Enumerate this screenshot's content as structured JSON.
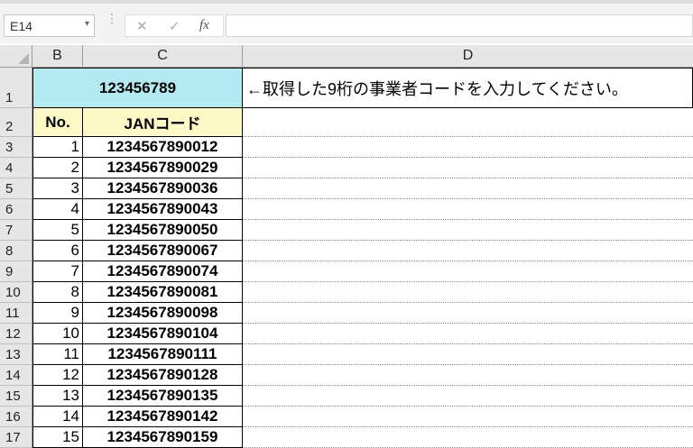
{
  "formula_bar": {
    "name_box": "E14",
    "name_box_caret": "▾",
    "separator": "⋮",
    "cancel_icon": "✕",
    "enter_icon": "✓",
    "function_icon": "fx",
    "formula_value": ""
  },
  "columns": [
    {
      "label": "B"
    },
    {
      "label": "C"
    },
    {
      "label": "D"
    }
  ],
  "row_numbers": [
    "1",
    "2",
    "3",
    "4",
    "5",
    "6",
    "7",
    "8",
    "9",
    "10",
    "11",
    "12",
    "13",
    "14",
    "15",
    "16",
    "17"
  ],
  "sheet": {
    "business_code": "123456789",
    "note": "←取得した9桁の事業者コードを入力してください。",
    "header_no": "No.",
    "header_jan": "JANコード",
    "rows": [
      {
        "no": "1",
        "jan": "1234567890012"
      },
      {
        "no": "2",
        "jan": "1234567890029"
      },
      {
        "no": "3",
        "jan": "1234567890036"
      },
      {
        "no": "4",
        "jan": "1234567890043"
      },
      {
        "no": "5",
        "jan": "1234567890050"
      },
      {
        "no": "6",
        "jan": "1234567890067"
      },
      {
        "no": "7",
        "jan": "1234567890074"
      },
      {
        "no": "8",
        "jan": "1234567890081"
      },
      {
        "no": "9",
        "jan": "1234567890098"
      },
      {
        "no": "10",
        "jan": "1234567890104"
      },
      {
        "no": "11",
        "jan": "1234567890111"
      },
      {
        "no": "12",
        "jan": "1234567890128"
      },
      {
        "no": "13",
        "jan": "1234567890135"
      },
      {
        "no": "14",
        "jan": "1234567890142"
      },
      {
        "no": "15",
        "jan": "1234567890159"
      }
    ]
  },
  "colors": {
    "code_fill": "#b3eaf2",
    "header_fill": "#fdf9c6",
    "header_gray": "#e6e6e6"
  }
}
